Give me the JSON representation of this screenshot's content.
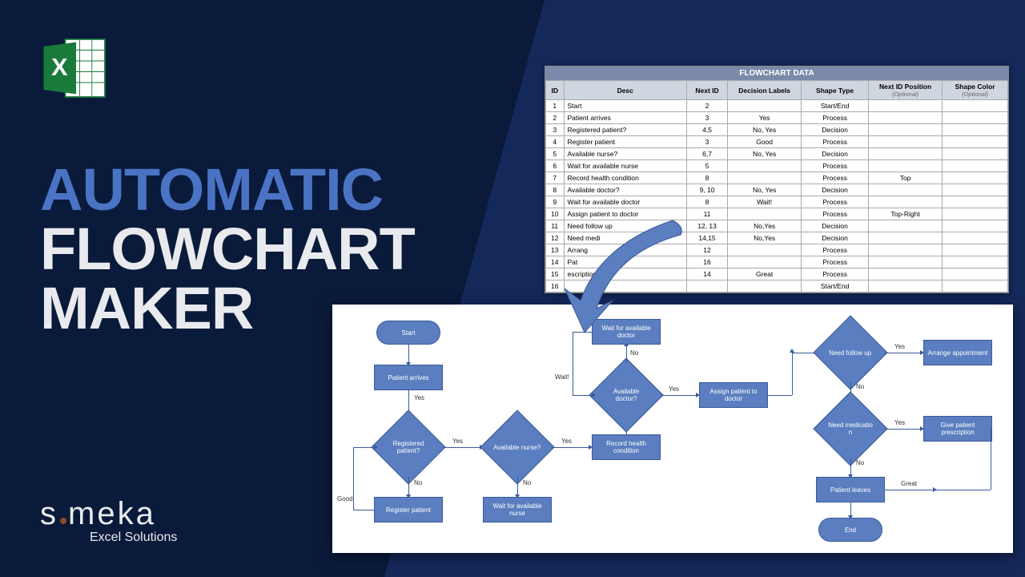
{
  "title": {
    "l1": "AUTOMATIC",
    "l2": "FLOWCHART",
    "l3": "MAKER"
  },
  "logo": {
    "brand_a": "s",
    "brand_b": "meka",
    "tag": "Excel Solutions"
  },
  "table": {
    "title": "FLOWCHART DATA",
    "headers": {
      "id": "ID",
      "desc": "Desc",
      "next": "Next ID",
      "dec": "Decision Labels",
      "shape": "Shape Type",
      "pos": "Next ID Position",
      "posopt": "(Optional)",
      "color": "Shape Color",
      "coloropt": "(Optional)"
    },
    "rows": [
      {
        "id": "1",
        "desc": "Start",
        "next": "2",
        "dec": "",
        "shape": "Start/End",
        "pos": "",
        "color": ""
      },
      {
        "id": "2",
        "desc": "Patient arrives",
        "next": "3",
        "dec": "Yes",
        "shape": "Process",
        "pos": "",
        "color": ""
      },
      {
        "id": "3",
        "desc": "Registered patient?",
        "next": "4,5",
        "dec": "No, Yes",
        "shape": "Decision",
        "pos": "",
        "color": ""
      },
      {
        "id": "4",
        "desc": "Register patient",
        "next": "3",
        "dec": "Good",
        "shape": "Process",
        "pos": "",
        "color": ""
      },
      {
        "id": "5",
        "desc": "Available nurse?",
        "next": "6,7",
        "dec": "No, Yes",
        "shape": "Decision",
        "pos": "",
        "color": ""
      },
      {
        "id": "6",
        "desc": "Wait for available nurse",
        "next": "5",
        "dec": "",
        "shape": "Process",
        "pos": "",
        "color": ""
      },
      {
        "id": "7",
        "desc": "Record health condition",
        "next": "8",
        "dec": "",
        "shape": "Process",
        "pos": "Top",
        "color": ""
      },
      {
        "id": "8",
        "desc": "Available doctor?",
        "next": "9, 10",
        "dec": "No, Yes",
        "shape": "Decision",
        "pos": "",
        "color": ""
      },
      {
        "id": "9",
        "desc": "Wait for available doctor",
        "next": "8",
        "dec": "Wait!",
        "shape": "Process",
        "pos": "",
        "color": ""
      },
      {
        "id": "10",
        "desc": "Assign patient to doctor",
        "next": "11",
        "dec": "",
        "shape": "Process",
        "pos": "Top-Right",
        "color": ""
      },
      {
        "id": "11",
        "desc": "Need follow up",
        "next": "12, 13",
        "dec": "No,Yes",
        "shape": "Decision",
        "pos": "",
        "color": ""
      },
      {
        "id": "12",
        "desc": "Need medi",
        "next": "14,15",
        "dec": "No,Yes",
        "shape": "Decision",
        "pos": "",
        "color": ""
      },
      {
        "id": "13",
        "desc": "Arrang",
        "next": "12",
        "dec": "",
        "shape": "Process",
        "pos": "",
        "color": ""
      },
      {
        "id": "14",
        "desc": "Pat",
        "next": "16",
        "dec": "",
        "shape": "Process",
        "pos": "",
        "color": ""
      },
      {
        "id": "15",
        "desc": "escription",
        "next": "14",
        "dec": "Great",
        "shape": "Process",
        "pos": "",
        "color": ""
      },
      {
        "id": "16",
        "desc": "",
        "next": "",
        "dec": "",
        "shape": "Start/End",
        "pos": "",
        "color": ""
      }
    ]
  },
  "flow": {
    "start": "Start",
    "arrives": "Patient arrives",
    "regq": "Registered patient?",
    "reg": "Register patient",
    "nurseq": "Available nurse?",
    "waitn": "Wait for available nurse",
    "rec": "Record health condition",
    "docq": "Available doctor?",
    "waitd": "Wait for available doctor",
    "assign": "Assign patient to doctor",
    "fup": "Need follow up",
    "medq": "Need medicatio n",
    "arrange": "Arrange appointment",
    "presc": "Give patient prescription",
    "leaves": "Patient leaves",
    "end": "End",
    "yes": "Yes",
    "no": "No",
    "good": "Good",
    "wait": "Wait!",
    "great": "Great"
  }
}
